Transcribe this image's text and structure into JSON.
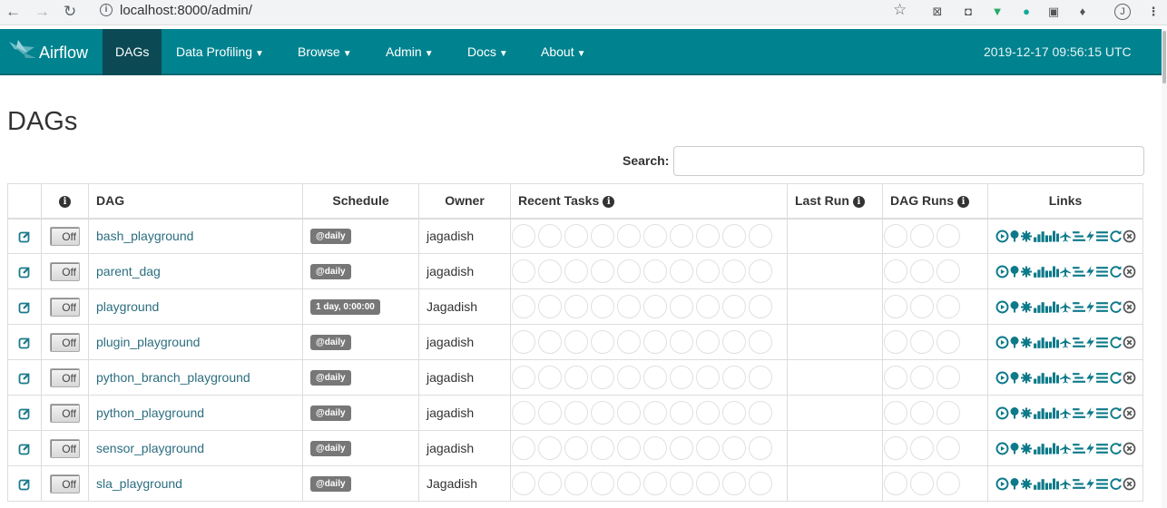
{
  "browser": {
    "url": "localhost:8000/admin/",
    "back": "←",
    "forward": "→",
    "reload": "↻"
  },
  "navbar": {
    "brand": "Airflow",
    "items": [
      {
        "label": "DAGs",
        "active": true
      },
      {
        "label": "Data Profiling"
      },
      {
        "label": "Browse"
      },
      {
        "label": "Admin"
      },
      {
        "label": "Docs"
      },
      {
        "label": "About"
      }
    ],
    "timestamp": "2019-12-17 09:56:15 UTC"
  },
  "page": {
    "title": "DAGs"
  },
  "search": {
    "label": "Search:",
    "value": ""
  },
  "table": {
    "headers": {
      "dag": "DAG",
      "schedule": "Schedule",
      "owner": "Owner",
      "recent_tasks": "Recent Tasks",
      "last_run": "Last Run",
      "dag_runs": "DAG Runs",
      "links": "Links"
    },
    "toggle_label": "Off",
    "rows": [
      {
        "dag": "bash_playground",
        "schedule": "@daily",
        "owner": "jagadish",
        "last_run": ""
      },
      {
        "dag": "parent_dag",
        "schedule": "@daily",
        "owner": "jagadish",
        "last_run": ""
      },
      {
        "dag": "playground",
        "schedule": "1 day, 0:00:00",
        "owner": "Jagadish",
        "last_run": ""
      },
      {
        "dag": "plugin_playground",
        "schedule": "@daily",
        "owner": "jagadish",
        "last_run": ""
      },
      {
        "dag": "python_branch_playground",
        "schedule": "@daily",
        "owner": "jagadish",
        "last_run": ""
      },
      {
        "dag": "python_playground",
        "schedule": "@daily",
        "owner": "jagadish",
        "last_run": ""
      },
      {
        "dag": "sensor_playground",
        "schedule": "@daily",
        "owner": "jagadish",
        "last_run": ""
      },
      {
        "dag": "sla_playground",
        "schedule": "@daily",
        "owner": "Jagadish",
        "last_run": ""
      }
    ]
  },
  "colors": {
    "navbar": "#00838f",
    "link": "#2c6e80",
    "badge": "#777777",
    "icon": "#0d7a8a"
  },
  "icons": [
    "trigger-dag-icon",
    "tree-view-icon",
    "graph-view-icon",
    "task-duration-icon",
    "task-tries-icon",
    "landing-times-icon",
    "gantt-icon",
    "code-view-icon",
    "logs-icon",
    "refresh-icon",
    "delete-icon"
  ]
}
